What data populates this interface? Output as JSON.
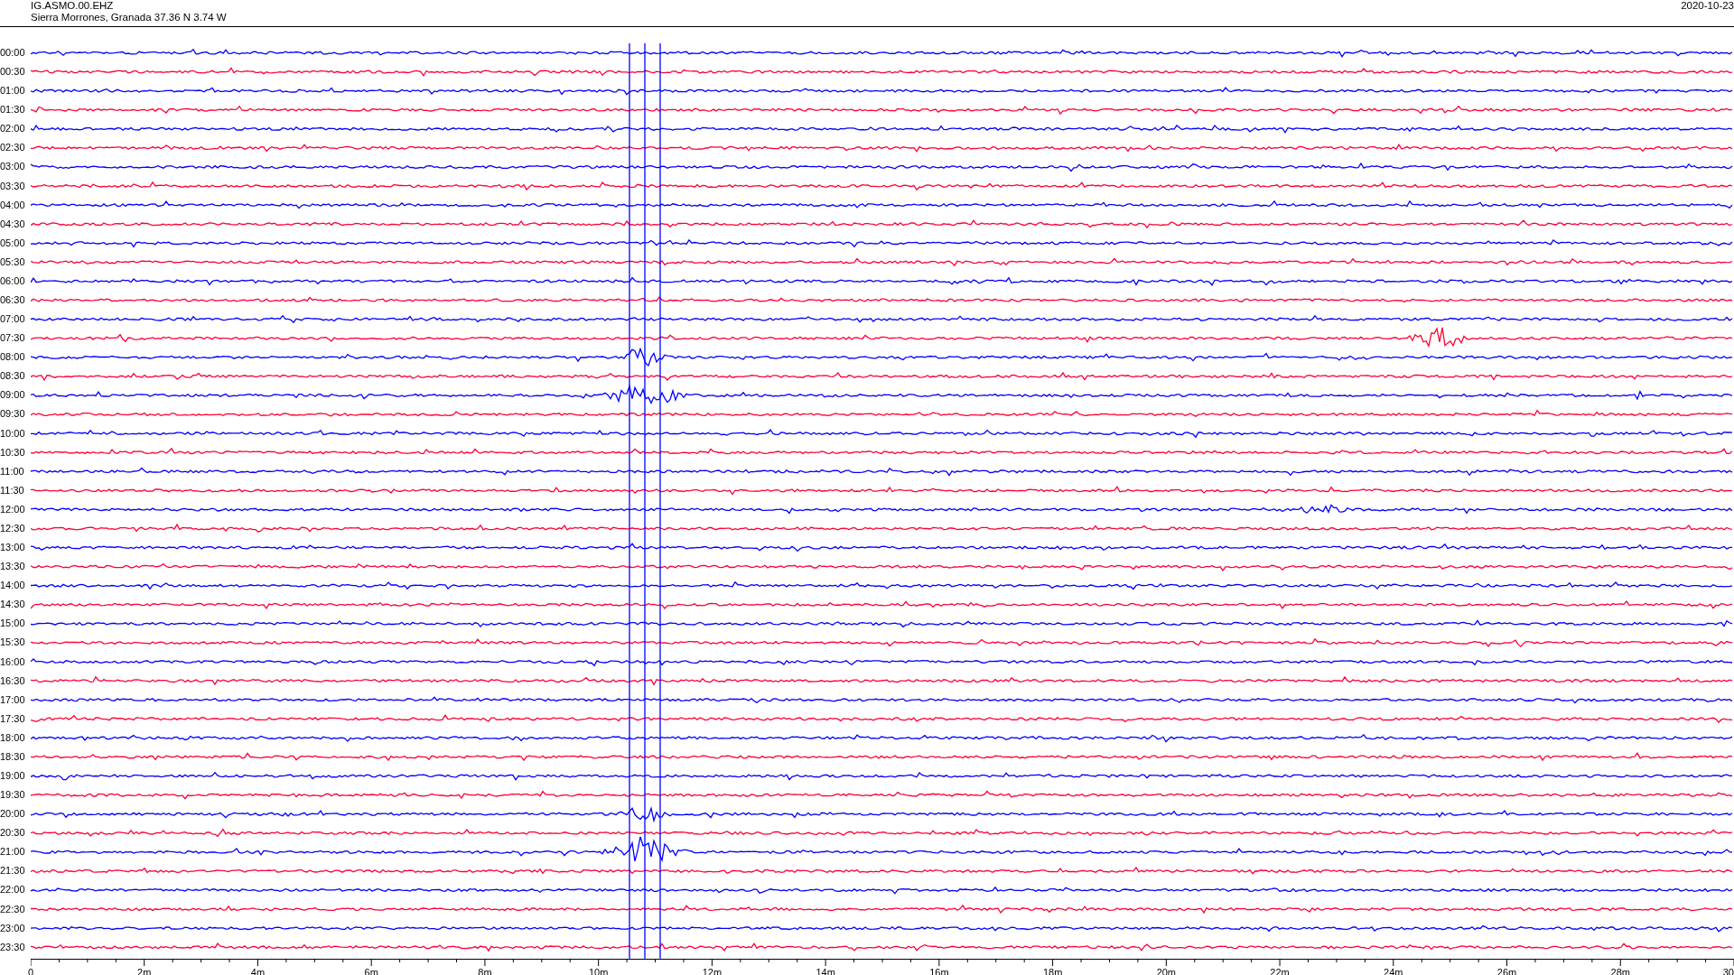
{
  "header": {
    "station": "IG.ASMO.00.EHZ",
    "location": "Sierra Morrones, Granada  37.36 N 3.74 W",
    "date": "2020-10-23"
  },
  "rows": [
    {
      "time": "00:00",
      "color": "#0000ff"
    },
    {
      "time": "00:30",
      "color": "#ff0033"
    },
    {
      "time": "01:00",
      "color": "#0000ff"
    },
    {
      "time": "01:30",
      "color": "#ff0033"
    },
    {
      "time": "02:00",
      "color": "#0000ff"
    },
    {
      "time": "02:30",
      "color": "#ff0033"
    },
    {
      "time": "03:00",
      "color": "#0000ff"
    },
    {
      "time": "03:30",
      "color": "#ff0033"
    },
    {
      "time": "04:00",
      "color": "#0000ff"
    },
    {
      "time": "04:30",
      "color": "#ff0033"
    },
    {
      "time": "05:00",
      "color": "#0000ff"
    },
    {
      "time": "05:30",
      "color": "#ff0033"
    },
    {
      "time": "06:00",
      "color": "#0000ff"
    },
    {
      "time": "06:30",
      "color": "#ff0033"
    },
    {
      "time": "07:00",
      "color": "#0000ff"
    },
    {
      "time": "07:30",
      "color": "#ff0033"
    },
    {
      "time": "08:00",
      "color": "#0000ff"
    },
    {
      "time": "08:30",
      "color": "#ff0033"
    },
    {
      "time": "09:00",
      "color": "#0000ff"
    },
    {
      "time": "09:30",
      "color": "#ff0033"
    },
    {
      "time": "10:00",
      "color": "#0000ff"
    },
    {
      "time": "10:30",
      "color": "#ff0033"
    },
    {
      "time": "11:00",
      "color": "#0000ff"
    },
    {
      "time": "11:30",
      "color": "#ff0033"
    },
    {
      "time": "12:00",
      "color": "#0000ff"
    },
    {
      "time": "12:30",
      "color": "#ff0033"
    },
    {
      "time": "13:00",
      "color": "#0000ff"
    },
    {
      "time": "13:30",
      "color": "#ff0033"
    },
    {
      "time": "14:00",
      "color": "#0000ff"
    },
    {
      "time": "14:30",
      "color": "#ff0033"
    },
    {
      "time": "15:00",
      "color": "#0000ff"
    },
    {
      "time": "15:30",
      "color": "#ff0033"
    },
    {
      "time": "16:00",
      "color": "#0000ff"
    },
    {
      "time": "16:30",
      "color": "#ff0033"
    },
    {
      "time": "17:00",
      "color": "#0000ff"
    },
    {
      "time": "17:30",
      "color": "#ff0033"
    },
    {
      "time": "18:00",
      "color": "#0000ff"
    },
    {
      "time": "18:30",
      "color": "#ff0033"
    },
    {
      "time": "19:00",
      "color": "#0000ff"
    },
    {
      "time": "19:30",
      "color": "#ff0033"
    },
    {
      "time": "20:00",
      "color": "#0000ff"
    },
    {
      "time": "20:30",
      "color": "#ff0033"
    },
    {
      "time": "21:00",
      "color": "#0000ff"
    },
    {
      "time": "21:30",
      "color": "#ff0033"
    },
    {
      "time": "22:00",
      "color": "#0000ff"
    },
    {
      "time": "22:30",
      "color": "#ff0033"
    },
    {
      "time": "23:00",
      "color": "#0000ff"
    },
    {
      "time": "23:30",
      "color": "#ff0033"
    }
  ],
  "x_axis": {
    "ticks": [
      "0",
      "2m",
      "4m",
      "6m",
      "8m",
      "10m",
      "12m",
      "14m",
      "16m",
      "18m",
      "20m",
      "22m",
      "24m",
      "26m",
      "28m",
      "30"
    ]
  }
}
